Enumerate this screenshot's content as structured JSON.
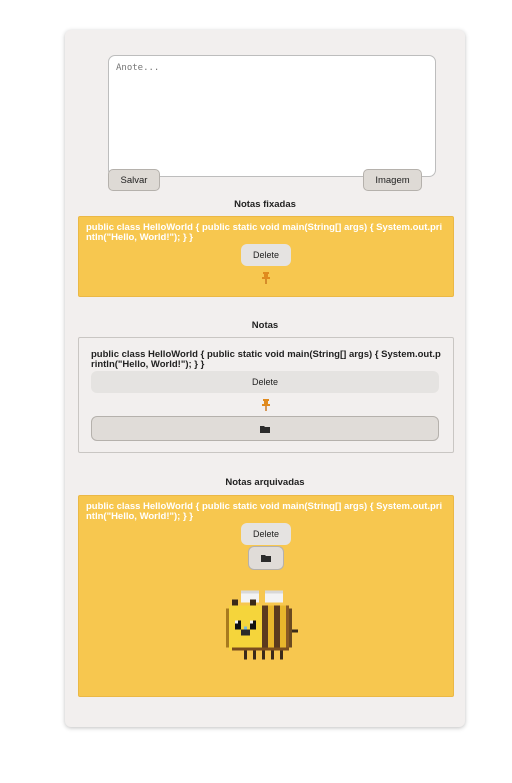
{
  "editor": {
    "placeholder": "Anote...",
    "save_label": "Salvar",
    "image_label": "Imagem"
  },
  "pinned": {
    "title": "Notas fixadas",
    "notes": [
      {
        "text": "public class HelloWorld { public static void main(String[] args) { System.out.println(\"Hello, World!\"); } }",
        "delete_label": "Delete",
        "pin_icon": "pin-icon"
      }
    ]
  },
  "notes": {
    "title": "Notas",
    "items": [
      {
        "text": "public class HelloWorld { public static void main(String[] args) { System.out.println(\"Hello, World!\"); } }",
        "delete_label": "Delete",
        "pin_icon": "pin-icon",
        "archive_icon": "folder-icon"
      }
    ]
  },
  "archived": {
    "title": "Notas arquivadas",
    "items": [
      {
        "text": "public class HelloWorld { public static void main(String[] args) { System.out.println(\"Hello, World!\"); } }",
        "delete_label": "Delete",
        "archive_icon": "folder-icon",
        "image": "pixel-bee-image"
      }
    ]
  },
  "colors": {
    "note_yellow": "#f7c74f",
    "pin_orange": "#e08a1e",
    "card_bg": "#f2efee"
  }
}
